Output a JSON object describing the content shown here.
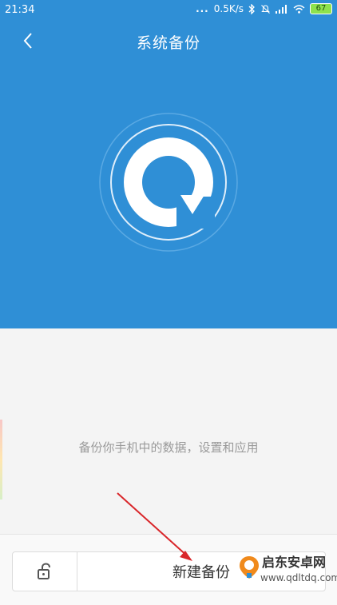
{
  "status_bar": {
    "time": "21:34",
    "dots": "...",
    "net_speed": "0.5K/s",
    "battery": "67",
    "icons": [
      "bluetooth-icon",
      "mute-icon",
      "signal-icon",
      "wifi-icon",
      "battery-icon"
    ]
  },
  "header": {
    "title": "系统备份",
    "back_icon": "chevron-left-icon"
  },
  "hero": {
    "logo_icon": "backup-refresh-icon",
    "background_color": "#2f8fd6"
  },
  "main": {
    "message": "备份你手机中的数据，设置和应用"
  },
  "bottom_bar": {
    "lock_icon": "unlock-icon",
    "new_backup_label": "新建备份"
  },
  "watermark": {
    "line1": "启东安卓网",
    "line2": "www.qdltdq.com"
  },
  "colors": {
    "accent": "#2f8fd6",
    "annotation_arrow": "#d9262a"
  }
}
